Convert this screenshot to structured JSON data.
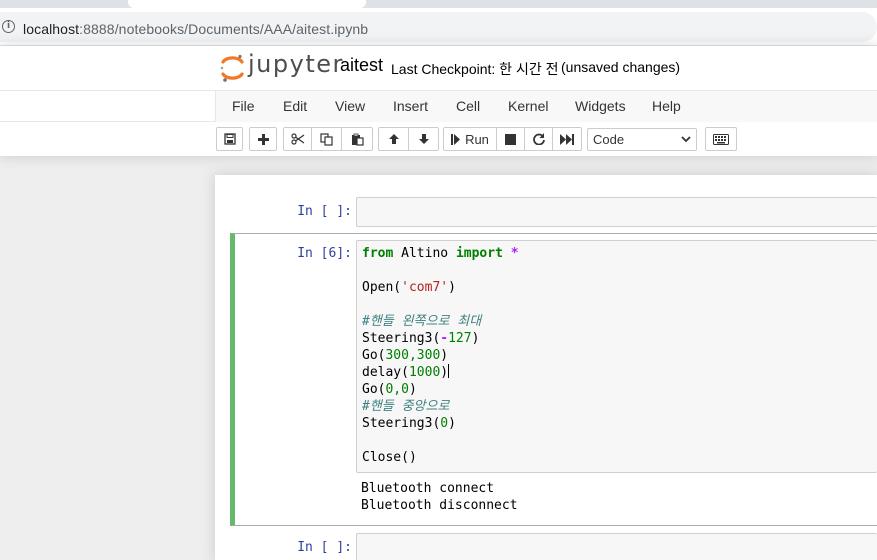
{
  "browser": {
    "url_host": "localhost",
    "url_rest": ":8888/notebooks/Documents/AAA/aitest.ipynb"
  },
  "header": {
    "logo_text": "jupyter",
    "notebook_name": "aitest",
    "checkpoint": "Last Checkpoint: 한 시간 전",
    "unsaved": "(unsaved changes)"
  },
  "menu": {
    "items": [
      "File",
      "Edit",
      "View",
      "Insert",
      "Cell",
      "Kernel",
      "Widgets",
      "Help"
    ]
  },
  "toolbar": {
    "run_label": "Run",
    "cell_type": "Code",
    "icons": [
      "save-icon",
      "plus-icon",
      "cut-icon",
      "copy-icon",
      "paste-icon",
      "arrow-up-icon",
      "arrow-down-icon",
      "step-forward-icon",
      "stop-icon",
      "restart-icon",
      "fast-forward-icon",
      "keyboard-icon"
    ]
  },
  "cells": {
    "c1": {
      "prompt": "In [ ]:"
    },
    "c2": {
      "prompt": "In [6]:",
      "code": {
        "l1_kw1": "from",
        "l1_mod": " Altino ",
        "l1_kw2": "import",
        "l1_op": " *",
        "l3a": "Open(",
        "l3s": "'com7'",
        "l3b": ")",
        "l5": "#핸들 왼쪽으로 최대",
        "l6a": "Steering3(",
        "l6op": "-",
        "l6n": "127",
        "l6b": ")",
        "l7a": "Go(",
        "l7n": "300,300",
        "l7b": ")",
        "l8a": "delay(",
        "l8n": "1000",
        "l8b": ")",
        "l9a": "Go(",
        "l9n": "0,0",
        "l9b": ")",
        "l10": "#핸들 중앙으로",
        "l11a": "Steering3(",
        "l11n": "0",
        "l11b": ")",
        "l13": "Close()"
      },
      "output": [
        "Bluetooth connect",
        "Bluetooth disconnect"
      ]
    },
    "c3": {
      "prompt": "In [ ]:"
    }
  },
  "colors": {
    "selected_cell_accent": "#66bb6a",
    "prompt": "#303f9f",
    "logo_orange": "#f37726"
  }
}
